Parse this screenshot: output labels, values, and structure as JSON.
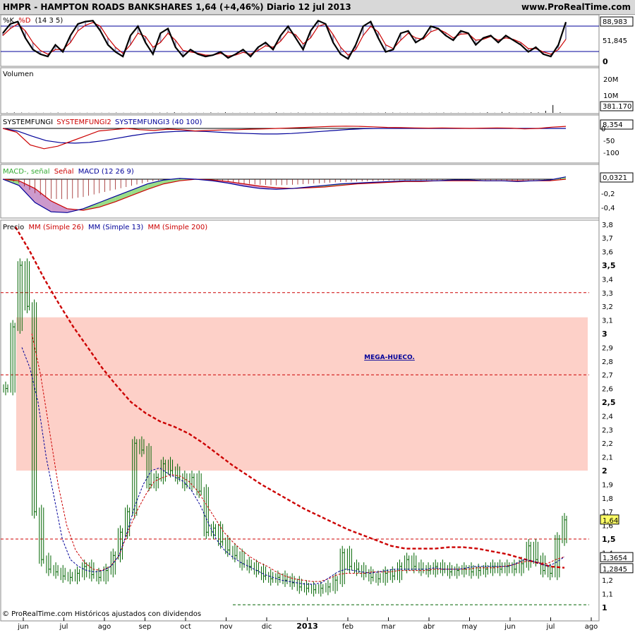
{
  "header": {
    "title": "HMPR - HAMPTON ROADS BANKSHARES    1,64 (+4,46%)    Diario  12 jul 2013",
    "site": "www.ProRealTime.com"
  },
  "footer": {
    "credit": "© ProRealTime.com  Históricos ajustados con dividendos"
  },
  "colors": {
    "gap_zone": "#fdd0c8",
    "price_bar": "#006400",
    "mm26": "#cc0000",
    "mm13": "#000099",
    "mm200": "#cc0000",
    "ref_line": "#cc0000",
    "stoch_k": "#000000",
    "stoch_d": "#cc0000",
    "volume": "#000000",
    "sf2": "#cc0000",
    "sf3": "#000099",
    "macd": "#000099",
    "signal": "#cc0000",
    "macd_hist": "#8b0000",
    "gap_label": "#000099"
  },
  "chart_data": [
    {
      "panel": "stochastic",
      "type": "line",
      "legend": "%K %D (14 3 5)",
      "legend_k": "%K",
      "legend_d": "%D",
      "legend_params": "(14 3 5)",
      "ylim": [
        0,
        100
      ],
      "levels": [
        80,
        20
      ],
      "last_k": "88,983",
      "last_d": "51,845",
      "tick_labels": [
        "0"
      ],
      "series": [
        {
          "name": "%K",
          "values": [
            65,
            85,
            90,
            55,
            30,
            20,
            15,
            40,
            25,
            60,
            85,
            90,
            92,
            70,
            40,
            25,
            15,
            60,
            80,
            45,
            20,
            65,
            75,
            35,
            15,
            30,
            20,
            15,
            18,
            25,
            12,
            20,
            30,
            15,
            35,
            45,
            30,
            60,
            80,
            55,
            30,
            70,
            92,
            85,
            45,
            20,
            10,
            40,
            80,
            90,
            55,
            25,
            30,
            65,
            70,
            45,
            55,
            80,
            75,
            60,
            50,
            70,
            65,
            40,
            55,
            60,
            45,
            60,
            50,
            40,
            25,
            35,
            20,
            15,
            40,
            89
          ]
        },
        {
          "name": "%D",
          "values": [
            60,
            75,
            85,
            70,
            45,
            28,
            20,
            30,
            30,
            45,
            70,
            82,
            88,
            80,
            55,
            35,
            22,
            40,
            65,
            58,
            35,
            45,
            65,
            50,
            28,
            25,
            22,
            18,
            18,
            22,
            16,
            18,
            24,
            20,
            28,
            38,
            35,
            48,
            68,
            62,
            42,
            55,
            80,
            85,
            62,
            35,
            18,
            30,
            60,
            80,
            68,
            40,
            32,
            50,
            65,
            55,
            52,
            68,
            74,
            66,
            55,
            63,
            64,
            50,
            52,
            58,
            50,
            55,
            52,
            45,
            32,
            32,
            25,
            20,
            30,
            52
          ]
        }
      ]
    },
    {
      "panel": "volume",
      "type": "bar",
      "legend": "Volumen",
      "ylim": [
        0,
        25000000
      ],
      "tick_labels": [
        "20M",
        "10M"
      ],
      "last_label": "381.170",
      "values": [
        0.2,
        0.3,
        0.2,
        0.1,
        0.1,
        0.1,
        0.1,
        0.2,
        0.1,
        0.1,
        0.1,
        0.1,
        0.1,
        0.1,
        0.1,
        0.2,
        0.1,
        0.1,
        0.1,
        0.1,
        0.1,
        0.2,
        0.2,
        0.4,
        0.1,
        0.1,
        0.1,
        0.1,
        0.3,
        0.1,
        0.4,
        0.1,
        0.1,
        0.1,
        0.2,
        0.1,
        0.1,
        0.4,
        0.1,
        0.1,
        0.2,
        0.1,
        0.1,
        0.1,
        0.1,
        0.1,
        0.1,
        0.1,
        0.1,
        0.1,
        0.1,
        0.1,
        0.3,
        0.2,
        0.1,
        0.1,
        0.1,
        0.1,
        0.1,
        0.1,
        0.2,
        0.1,
        0.1,
        0.1,
        0.1,
        0.1,
        0.4,
        0.1,
        0.5,
        0.3,
        0.1,
        0.1,
        0.4,
        0.3,
        1.2,
        4.5,
        0.4
      ]
    },
    {
      "panel": "systemfungi",
      "type": "line",
      "legend_parts": [
        "SYSTEMFUNGI",
        "SYSTEMFUNGI2",
        "SYSTEMFUNGI3 (40 100)"
      ],
      "ylim": [
        -125,
        30
      ],
      "last_value": "8,354",
      "tick_labels": [
        "0",
        "-50",
        "-100"
      ],
      "series": [
        {
          "name": "SYSTEMFUNGI",
          "values": [
            0,
            0
          ]
        },
        {
          "name": "SYSTEMFUNGI2",
          "values": [
            0,
            -15,
            -65,
            -80,
            -70,
            -50,
            -30,
            -10,
            -5,
            0,
            -5,
            -8,
            -3,
            -5,
            -10,
            -8,
            -6,
            -5,
            -3,
            -2,
            0,
            2,
            4,
            6,
            8,
            9,
            8,
            6,
            4,
            3,
            2,
            1,
            2,
            1,
            0,
            1,
            2,
            1,
            -2,
            0,
            5,
            8
          ]
        },
        {
          "name": "SYSTEMFUNGI3",
          "values": [
            0,
            -10,
            -30,
            -48,
            -56,
            -58,
            -55,
            -48,
            -38,
            -28,
            -20,
            -15,
            -12,
            -10,
            -12,
            -15,
            -18,
            -20,
            -22,
            -22,
            -20,
            -16,
            -12,
            -8,
            -4,
            -1,
            0,
            0,
            0,
            0,
            0,
            0,
            0,
            0,
            0,
            0,
            0,
            0,
            0,
            0
          ]
        }
      ]
    },
    {
      "panel": "macd",
      "type": "line",
      "legend_parts": [
        "MACD-, señal",
        "Señal",
        "MACD (12 26 9)"
      ],
      "ylim": [
        -0.55,
        0.15
      ],
      "last_value": "0,0321",
      "tick_labels": [
        "-0,2",
        "-0,4"
      ],
      "series": [
        {
          "name": "MACD",
          "values": [
            0,
            -0.08,
            -0.3,
            -0.42,
            -0.43,
            -0.38,
            -0.3,
            -0.22,
            -0.14,
            -0.06,
            -0.01,
            0.01,
            0.0,
            -0.02,
            -0.05,
            -0.09,
            -0.12,
            -0.13,
            -0.12,
            -0.1,
            -0.08,
            -0.06,
            -0.05,
            -0.04,
            -0.03,
            -0.02,
            -0.02,
            -0.02,
            -0.01,
            -0.01,
            -0.02,
            -0.02,
            -0.03,
            -0.02,
            -0.01,
            0.03
          ]
        },
        {
          "name": "Señal",
          "values": [
            0,
            -0.02,
            -0.12,
            -0.28,
            -0.38,
            -0.4,
            -0.36,
            -0.29,
            -0.21,
            -0.13,
            -0.06,
            -0.02,
            0.0,
            -0.01,
            -0.03,
            -0.06,
            -0.09,
            -0.11,
            -0.12,
            -0.11,
            -0.1,
            -0.08,
            -0.06,
            -0.05,
            -0.04,
            -0.03,
            -0.03,
            -0.02,
            -0.02,
            -0.02,
            -0.02,
            -0.02,
            -0.02,
            -0.02,
            -0.02,
            0.0
          ]
        }
      ]
    },
    {
      "panel": "price",
      "type": "bar",
      "legend_parts": [
        "Precio",
        "MM (Simple 26)",
        "MM (Simple 13)",
        "MM (Simple 200)"
      ],
      "ylim": [
        0.95,
        3.8
      ],
      "x_labels": [
        "jun",
        "jul",
        "ago",
        "sep",
        "oct",
        "nov",
        "dic",
        "2013",
        "feb",
        "mar",
        "abr",
        "may",
        "jun",
        "jul",
        "ago"
      ],
      "y_ticks": [
        "3,8",
        "3,7",
        "3,6",
        "3,5",
        "3,4",
        "3,3",
        "3,2",
        "3,1",
        "3",
        "2,9",
        "2,8",
        "2,7",
        "2,6",
        "2,5",
        "2,4",
        "2,3",
        "2,2",
        "2,1",
        "2",
        "1,9",
        "1,8",
        "1,7",
        "1,6",
        "1,5",
        "1,4",
        "1,3",
        "1,2",
        "1,1",
        "1"
      ],
      "y_ticks_bold": [
        "3,5",
        "3",
        "2,5",
        "2",
        "1,5",
        "1"
      ],
      "last_price": "1,64",
      "mm26_label": "1,3654",
      "mm200_label": "1,2845",
      "reference_lines": [
        3.3,
        2.7,
        1.5,
        1.02
      ],
      "gap_zone": {
        "from": 2.0,
        "to": 3.12,
        "label": "MEGA-HUECO."
      },
      "closes": [
        2.6,
        3.05,
        3.5,
        3.2,
        1.7,
        1.35,
        1.28,
        1.26,
        1.23,
        1.22,
        1.25,
        1.3,
        1.24,
        1.22,
        1.27,
        1.38,
        1.55,
        1.7,
        2.2,
        2.15,
        1.9,
        1.95,
        2.05,
        2.0,
        1.95,
        1.9,
        1.95,
        1.85,
        1.55,
        1.58,
        1.48,
        1.42,
        1.38,
        1.32,
        1.3,
        1.27,
        1.23,
        1.21,
        1.22,
        1.2,
        1.18,
        1.15,
        1.14,
        1.13,
        1.14,
        1.15,
        1.2,
        1.4,
        1.3,
        1.28,
        1.25,
        1.22,
        1.21,
        1.25,
        1.23,
        1.3,
        1.35,
        1.3,
        1.28,
        1.27,
        1.3,
        1.28,
        1.26,
        1.27,
        1.28,
        1.26,
        1.27,
        1.28,
        1.3,
        1.28,
        1.3,
        1.28,
        1.32,
        1.45,
        1.35,
        1.27,
        1.25,
        1.5,
        1.64
      ],
      "mm13": [
        null,
        null,
        2.9,
        2.75,
        2.5,
        2.1,
        1.8,
        1.5,
        1.35,
        1.3,
        1.27,
        1.26,
        1.27,
        1.3,
        1.38,
        1.55,
        1.75,
        1.9,
        2.0,
        2.02,
        1.98,
        1.95,
        1.92,
        1.85,
        1.75,
        1.62,
        1.5,
        1.42,
        1.37,
        1.33,
        1.3,
        1.27,
        1.24,
        1.22,
        1.2,
        1.19,
        1.18,
        1.17,
        1.17,
        1.18,
        1.22,
        1.26,
        1.28,
        1.27,
        1.26,
        1.25,
        1.26,
        1.27,
        1.28,
        1.28,
        1.28,
        1.28,
        1.28,
        1.29,
        1.28,
        1.28,
        1.28,
        1.29,
        1.3,
        1.3,
        1.3,
        1.3,
        1.3,
        1.32,
        1.35,
        1.34,
        1.32,
        1.3,
        1.33,
        1.37
      ],
      "mm26": [
        null,
        null,
        null,
        3.0,
        2.7,
        2.3,
        1.9,
        1.6,
        1.42,
        1.33,
        1.28,
        1.27,
        1.3,
        1.38,
        1.55,
        1.7,
        1.82,
        1.92,
        1.95,
        1.97,
        1.96,
        1.92,
        1.85,
        1.75,
        1.65,
        1.55,
        1.48,
        1.42,
        1.37,
        1.33,
        1.3,
        1.26,
        1.23,
        1.21,
        1.2,
        1.19,
        1.19,
        1.21,
        1.24,
        1.25,
        1.25,
        1.25,
        1.26,
        1.26,
        1.26,
        1.27,
        1.27,
        1.27,
        1.27,
        1.28,
        1.28,
        1.28,
        1.28,
        1.28,
        1.29,
        1.29,
        1.29,
        1.3,
        1.31,
        1.33,
        1.34,
        1.33,
        1.32,
        1.35,
        1.37
      ],
      "mm200": [
        3.78,
        3.6,
        3.4,
        3.22,
        3.05,
        2.9,
        2.75,
        2.62,
        2.5,
        2.42,
        2.36,
        2.32,
        2.27,
        2.2,
        2.12,
        2.04,
        1.97,
        1.9,
        1.84,
        1.78,
        1.72,
        1.67,
        1.62,
        1.57,
        1.53,
        1.49,
        1.45,
        1.43,
        1.43,
        1.43,
        1.44,
        1.44,
        1.43,
        1.41,
        1.39,
        1.36,
        1.33,
        1.3,
        1.29
      ]
    }
  ]
}
